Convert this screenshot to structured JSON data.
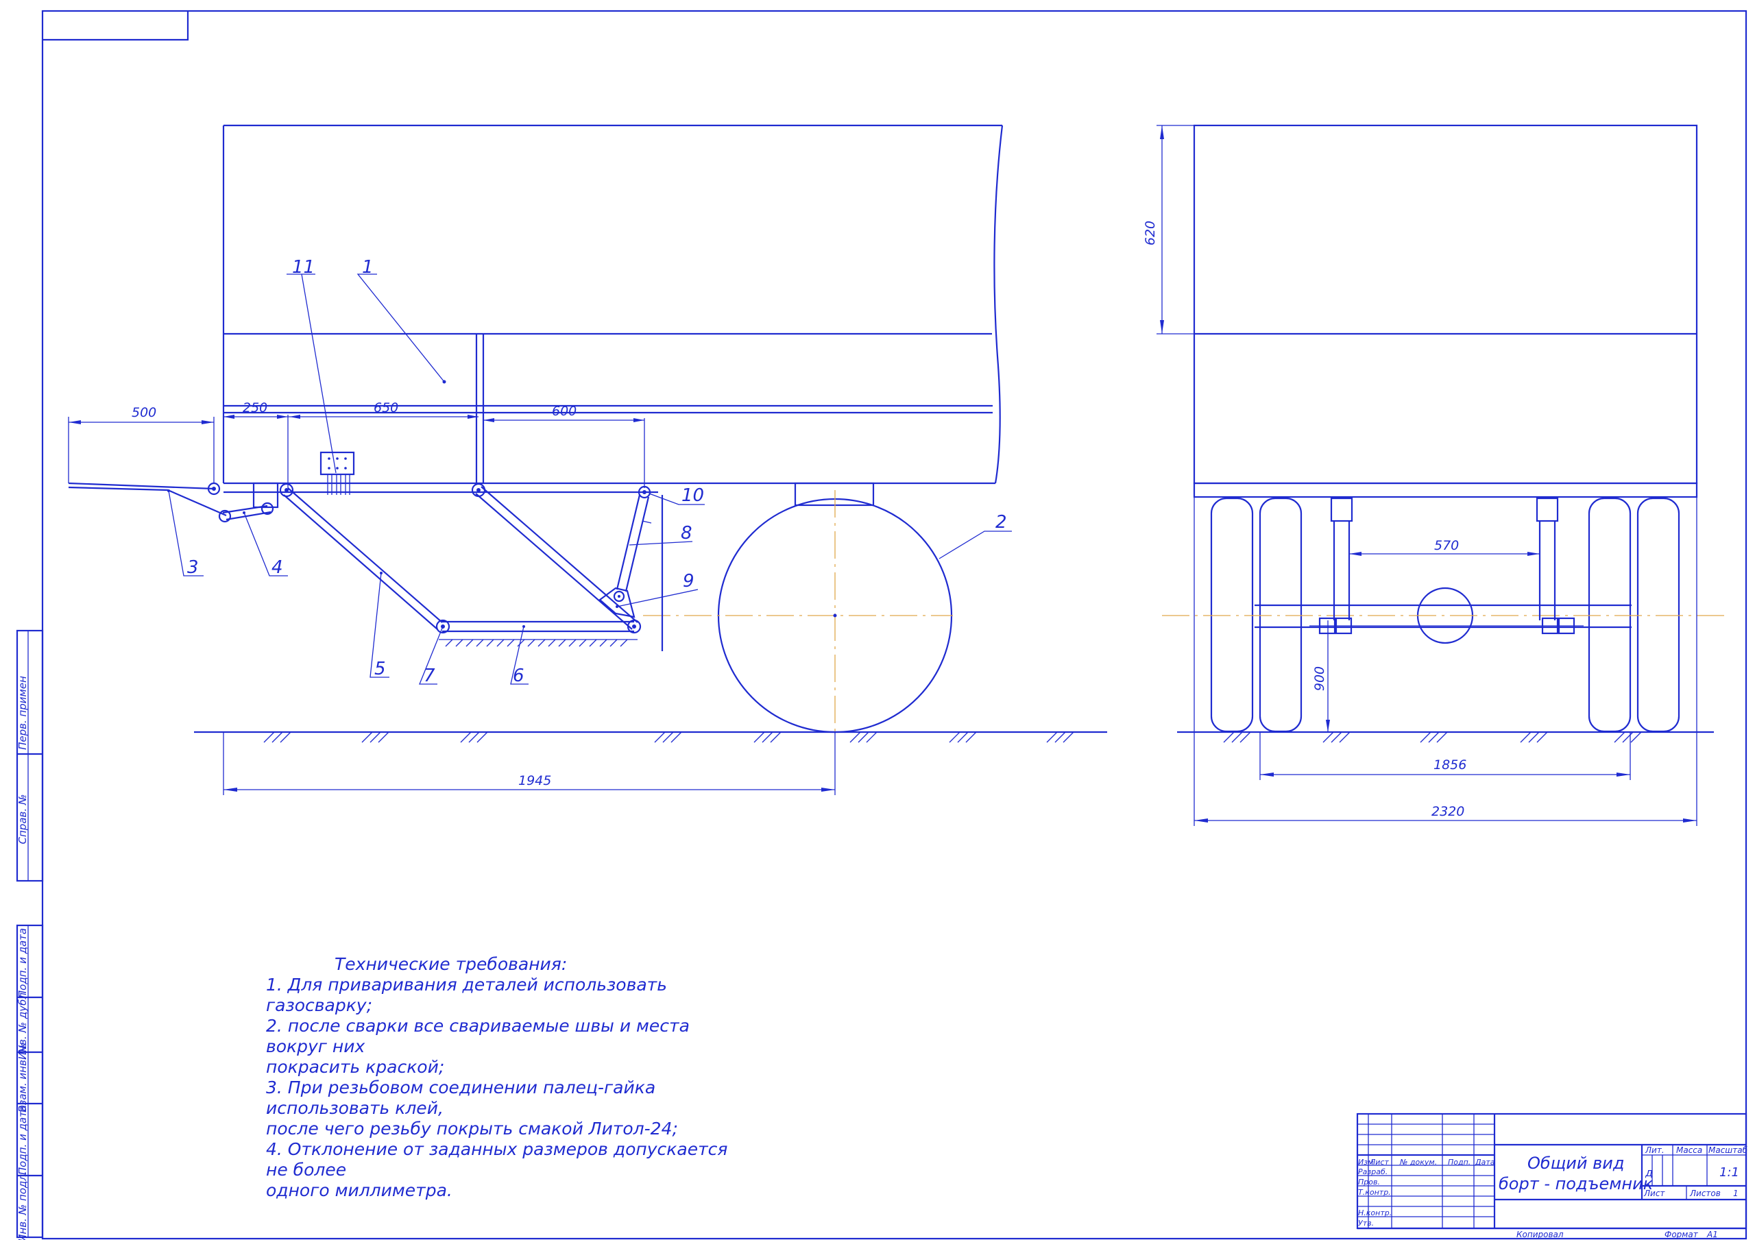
{
  "leaders": {
    "n1": "1",
    "n2": "2",
    "n3": "3",
    "n4": "4",
    "n5": "5",
    "n6": "6",
    "n7": "7",
    "n8": "8",
    "n9": "9",
    "n10": "10",
    "n11": "11"
  },
  "dimensions": {
    "d500": "500",
    "d250": "250",
    "d650": "650",
    "d600": "600",
    "d1945": "1945",
    "d620": "620",
    "d570": "570",
    "d900": "900",
    "d1856": "1856",
    "d2320": "2320"
  },
  "notes": {
    "title": "Технические требования:",
    "lines": [
      "1.  Для приваривания деталей использовать газосварку;",
      "2. после сварки все свариваемые швы и места вокруг них",
      "покрасить краской;",
      "3. При резьбовом соединении палец-гайка использовать клей,",
      "после чего резьбу покрыть смакой Литол-24;",
      "4. Отклонение от заданных размеров допускается не более",
      "одного миллиметра."
    ]
  },
  "side_stamps": [
    "Перв. примен",
    "Справ. №",
    "Подп. и дата",
    "Инв. № дубл",
    "Взам. инв. №",
    "Подп. и дата",
    "Инв. № подл."
  ],
  "title_block": {
    "title_line1": "Общий вид",
    "title_line2": "борт - подъемник",
    "col_izm": "Изм",
    "col_list": "Лист",
    "col_doc": "№ докум.",
    "col_podp": "Подп.",
    "col_date": "Дата",
    "row_razrab": "Разраб.",
    "row_prov": "Пров.",
    "row_tkontr": "Т.контр.",
    "row_nkontr": "Н.контр.",
    "row_utv": "Утв.",
    "lit": "Лит.",
    "massa": "Масса",
    "masshtab": "Масштаб",
    "lit_value": "д",
    "scale_value": "1:1",
    "sheet": "Лист",
    "sheets": "Листов",
    "sheets_value": "1",
    "kopiroval": "Копировал",
    "format": "Формат",
    "format_value": "А1"
  },
  "colors": {
    "lines": "#1f2bd0",
    "centerline": "#e0a84a",
    "background": "#ffffff"
  }
}
